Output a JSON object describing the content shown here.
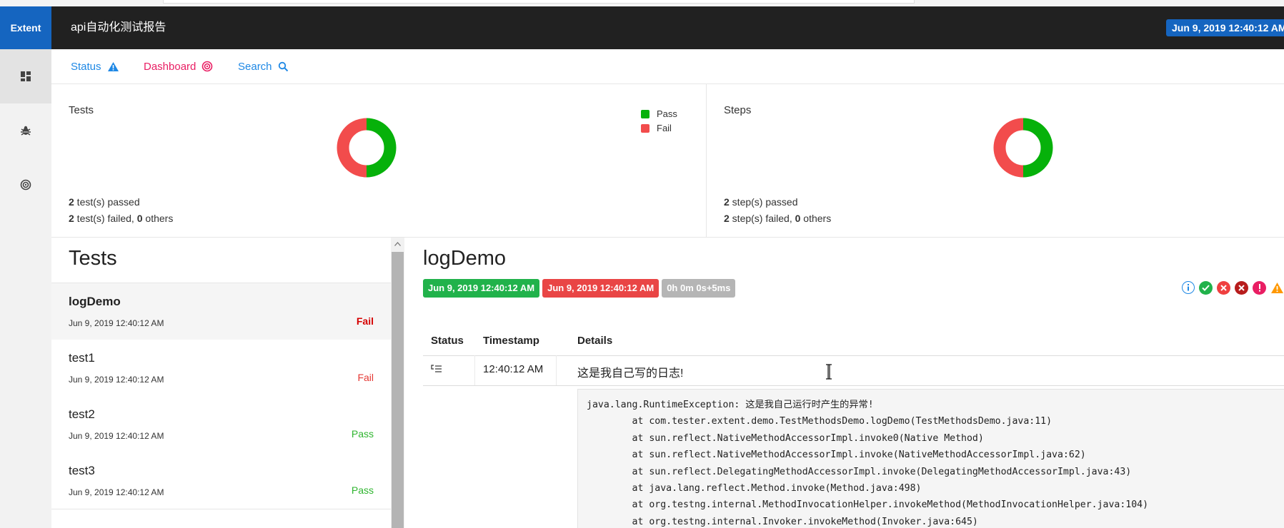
{
  "brand": "Extent",
  "report_title": "api自动化测试报告",
  "report_time": "Jun 9, 2019 12:40:12 AM",
  "sidebar": {
    "items": [
      {
        "icon": "dashboard-icon",
        "active": true
      },
      {
        "icon": "bug-icon",
        "active": false
      },
      {
        "icon": "radar-icon",
        "active": false
      }
    ]
  },
  "subnav": {
    "status_label": "Status",
    "dashboard_label": "Dashboard",
    "search_label": "Search"
  },
  "colors": {
    "pass": "#06b10a",
    "fail": "#f24c4c",
    "accent": "#1565c0",
    "header": "#212121"
  },
  "tests_card": {
    "title": "Tests",
    "legend": [
      {
        "label": "Pass",
        "color": "#06b10a"
      },
      {
        "label": "Fail",
        "color": "#f24c4c"
      }
    ],
    "passed_count": "2",
    "passed_text": " test(s) passed",
    "failed_count": "2",
    "failed_text": " test(s) failed, ",
    "others_count": "0",
    "others_text": " others",
    "pass_fraction": 0.5
  },
  "steps_card": {
    "title": "Steps",
    "passed_count": "2",
    "passed_text": " step(s) passed",
    "failed_count": "2",
    "failed_text": " step(s) failed, ",
    "others_count": "0",
    "others_text": " others",
    "pass_fraction": 0.5
  },
  "test_list": {
    "title": "Tests",
    "items": [
      {
        "name": "logDemo",
        "date": "Jun 9, 2019 12:40:12 AM",
        "status": "Fail"
      },
      {
        "name": "test1",
        "date": "Jun 9, 2019 12:40:12 AM",
        "status": "Fail"
      },
      {
        "name": "test2",
        "date": "Jun 9, 2019 12:40:12 AM",
        "status": "Pass"
      },
      {
        "name": "test3",
        "date": "Jun 9, 2019 12:40:12 AM",
        "status": "Pass"
      }
    ]
  },
  "detail": {
    "title": "logDemo",
    "start_time": "Jun 9, 2019 12:40:12 AM",
    "end_time": "Jun 9, 2019 12:40:12 AM",
    "duration": "0h 0m 0s+5ms",
    "filter_icons": [
      "info-icon",
      "pass-icon",
      "fail-icon",
      "fatal-icon",
      "error-icon",
      "warning-icon"
    ],
    "columns": {
      "status": "Status",
      "timestamp": "Timestamp",
      "details": "Details"
    },
    "log_row": {
      "status_icon": "log-list-icon",
      "timestamp": "12:40:12 AM",
      "details": "这是我自己写的日志!"
    },
    "exception": "java.lang.RuntimeException: 这是我自己运行时产生的异常!\n\tat com.tester.extent.demo.TestMethodsDemo.logDemo(TestMethodsDemo.java:11)\n\tat sun.reflect.NativeMethodAccessorImpl.invoke0(Native Method)\n\tat sun.reflect.NativeMethodAccessorImpl.invoke(NativeMethodAccessorImpl.java:62)\n\tat sun.reflect.DelegatingMethodAccessorImpl.invoke(DelegatingMethodAccessorImpl.java:43)\n\tat java.lang.reflect.Method.invoke(Method.java:498)\n\tat org.testng.internal.MethodInvocationHelper.invokeMethod(MethodInvocationHelper.java:104)\n\tat org.testng.internal.Invoker.invokeMethod(Invoker.java:645)"
  }
}
